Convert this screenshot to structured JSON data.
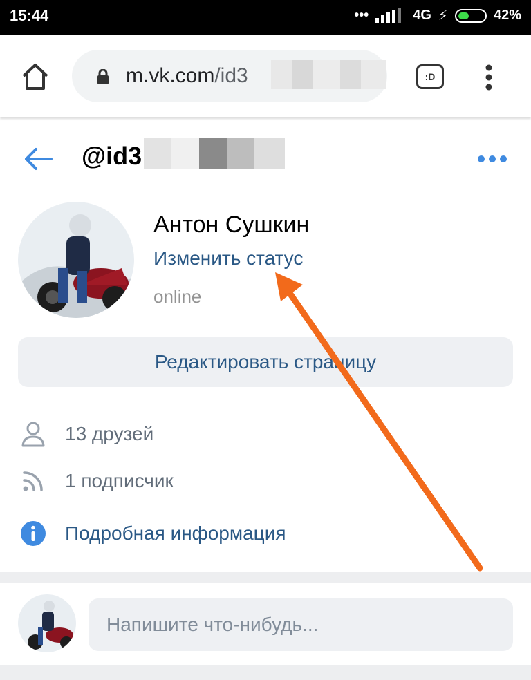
{
  "status_bar": {
    "time": "15:44",
    "network": "4G",
    "battery": "42%",
    "battery_level": 0.42
  },
  "browser": {
    "url_host": "m.vk.com",
    "url_rest": "/id3",
    "tab_icon": ":D",
    "menu_icon": "more-vert-icon"
  },
  "header": {
    "handle": "@id3",
    "back_icon": "arrow-left-icon",
    "more_icon": "more-horiz-icon"
  },
  "profile": {
    "name": "Антон Сушкин",
    "change_status": "Изменить статус",
    "presence": "online",
    "edit_button": "Редактировать страницу"
  },
  "info": [
    {
      "icon": "person-icon",
      "text": "13 друзей"
    },
    {
      "icon": "rss-icon",
      "text": "1 подписчик"
    },
    {
      "icon": "info-icon",
      "text": "Подробная информация"
    }
  ],
  "composer": {
    "placeholder": "Напишите что-нибудь..."
  },
  "colors": {
    "link": "#2a5885",
    "accent": "#3f8ae0",
    "annotation_arrow": "#f26a1b"
  }
}
